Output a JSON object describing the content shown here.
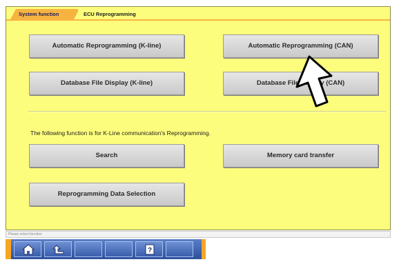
{
  "tabs": [
    {
      "label": "System function"
    },
    {
      "label": "ECU Reprogramming"
    }
  ],
  "buttons": {
    "auto_kline": "Automatic Reprogramming (K-line)",
    "auto_can": "Automatic Reprogramming (CAN)",
    "db_kline": "Database File Display (K-line)",
    "db_can": "Database File Display (CAN)",
    "search": "Search",
    "memory_card": "Memory card transfer",
    "data_selection": "Reprogramming Data Selection"
  },
  "info_text": "The following function is for K-Line communication's Reprogramming.",
  "status_text": "Please select function",
  "toolbar": {
    "home_icon": "home-icon",
    "back_icon": "back-arrow-icon",
    "help_icon": "help-icon",
    "help_glyph": "?"
  },
  "colors": {
    "panel_bg": "#fdfd7d",
    "tab_accent": "#f7b340",
    "toolbar_blue": "#3b5eab",
    "toolbar_cap": "#f5a623"
  }
}
